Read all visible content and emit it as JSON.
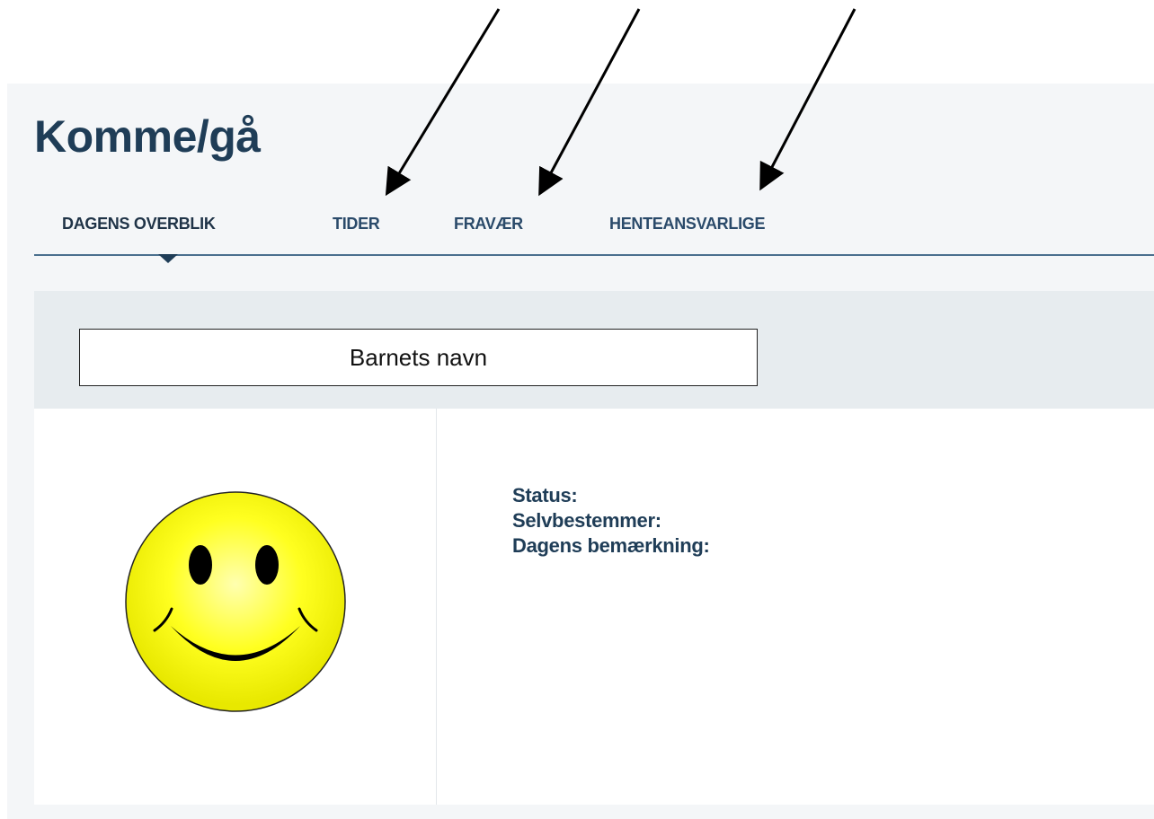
{
  "page": {
    "title": "Komme/gå"
  },
  "tabs": [
    {
      "label": "DAGENS OVERBLIK",
      "active": true
    },
    {
      "label": "TIDER",
      "active": false
    },
    {
      "label": "FRAVÆR",
      "active": false
    },
    {
      "label": "HENTEANSVARLIGE",
      "active": false
    }
  ],
  "child": {
    "name": "Barnets navn",
    "avatar_icon": "smiley-face-icon",
    "status_label": "Status:",
    "self_determiner_label": "Selvbestemmer:",
    "daily_note_label": "Dagens bemærkning:"
  },
  "annotations": {
    "arrow_icon": "arrow-icon",
    "targets": [
      "TIDER",
      "FRAVÆR",
      "HENTEANSVARLIGE"
    ]
  },
  "colors": {
    "brand_dark": "#1f3d57",
    "tab_text": "#2a4a6a",
    "page_bg": "#f4f6f8",
    "header_band_bg": "#e7ecef",
    "smiley_yellow": "#ffff00"
  }
}
